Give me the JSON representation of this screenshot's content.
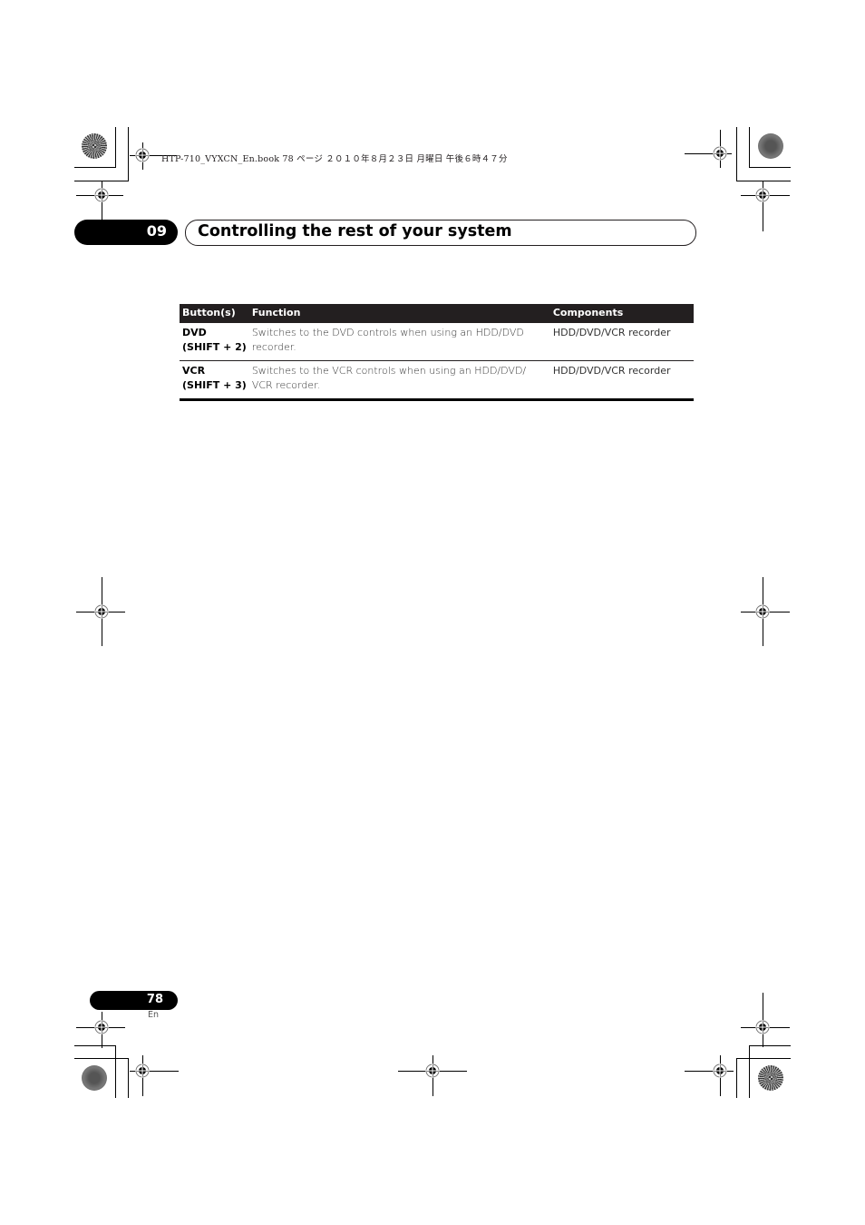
{
  "print_header": {
    "text": "HTP-710_VYXCN_En.book   78 ページ   ２０１０年８月２３日   月曜日   午後６時４７分"
  },
  "chapter": {
    "number": "09",
    "title": "Controlling the rest of your system"
  },
  "table": {
    "columns": [
      "Button(s)",
      "Function",
      "Components"
    ],
    "rows": [
      {
        "button_line1": "DVD",
        "button_line2": "(SHIFT + 2)",
        "function": "Switches to the DVD controls when using an HDD/DVD recorder.",
        "components": "HDD/DVD/VCR recorder"
      },
      {
        "button_line1": "VCR",
        "button_line2": "(SHIFT + 3)",
        "function": "Switches to the VCR controls when using an HDD/DVD/ VCR recorder.",
        "components": "HDD/DVD/VCR recorder"
      }
    ]
  },
  "footer": {
    "page_number": "78",
    "language": "En"
  }
}
